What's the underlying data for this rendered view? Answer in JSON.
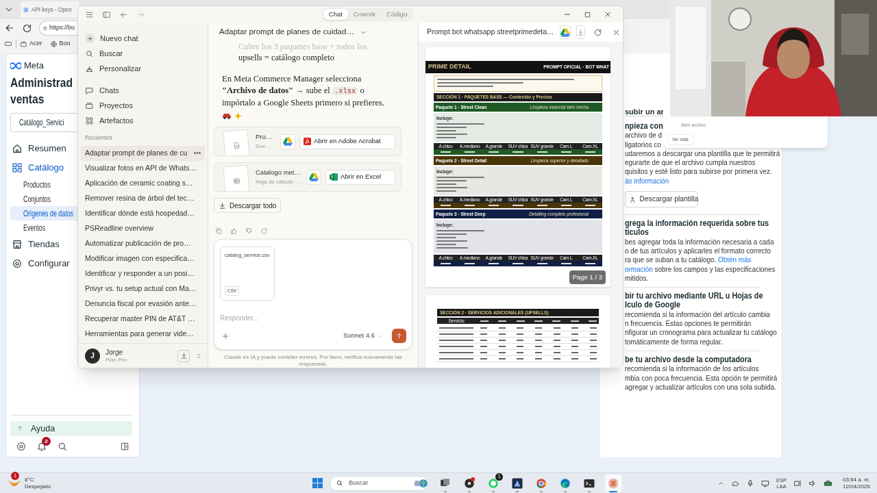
{
  "browser": {
    "tab_title": "API keys - Open",
    "address": "https://bu",
    "bookmarks": [
      "Acer",
      "Boo"
    ]
  },
  "meta_sidebar": {
    "logo": "Meta",
    "title": [
      "Administrad",
      "ventas"
    ],
    "catalog_selector": "Catálogo_Servici",
    "nav": [
      {
        "label": "Resumen",
        "kind": "section",
        "selected": false
      },
      {
        "label": "Catálogo",
        "kind": "section",
        "selected": true
      },
      {
        "label": "Productos",
        "kind": "sub",
        "selected": false
      },
      {
        "label": "Conjuntos",
        "kind": "sub",
        "selected": false
      },
      {
        "label": "Orígenes de datos",
        "kind": "sub",
        "selected": true
      },
      {
        "label": "Eventos",
        "kind": "sub",
        "selected": false
      },
      {
        "label": "Tiendas",
        "kind": "section",
        "selected": false
      },
      {
        "label": "Configurar",
        "kind": "section",
        "selected": false
      }
    ],
    "help": "Ayuda",
    "notification_count": "2"
  },
  "meta_content": {
    "tab": "subir un ar",
    "blocks": [
      {
        "kind": "heading",
        "lines": [
          [
            "npieza con"
          ]
        ]
      },
      {
        "kind": "text",
        "lines": [
          [
            "archivo de d"
          ],
          [
            "ligatorios co"
          ],
          [
            "udaremos a descargar una plantilla que te permitirá"
          ],
          [
            "egurarte de que el archivo cumpla nuestros"
          ],
          [
            "quisitos y esté listo para subirse por primera vez."
          ],
          [
            {
              "link": "ás información"
            }
          ]
        ]
      },
      {
        "kind": "button",
        "label": "Descargar plantilla"
      },
      {
        "kind": "heading",
        "lines": [
          [
            "grega la información requerida sobre tus"
          ],
          [
            "tículos"
          ]
        ]
      },
      {
        "kind": "text",
        "lines": [
          [
            "bes agregar toda la información necesaria a cada"
          ],
          [
            "o de tus artículos y aplicarles el formato correcto"
          ],
          [
            "ra que se suban a tu catálogo. ",
            {
              "link": "Obtén más"
            }
          ],
          [
            {
              "link": "ormación"
            },
            " sobre los campos y las especificaciones"
          ],
          [
            "mitidos."
          ]
        ]
      },
      {
        "kind": "heading",
        "lines": [
          [
            "bir tu archivo mediante URL u Hojas de"
          ],
          [
            "lculo de Google"
          ]
        ]
      },
      {
        "kind": "text",
        "lines": [
          [
            "recomienda si la información del artículo cambia"
          ],
          [
            "n frecuencia. Estas opciones te permitirán"
          ],
          [
            "nfigurar un cronograma para actualizar tu catálogo"
          ],
          [
            "tomáticamente de forma regular."
          ]
        ]
      },
      {
        "kind": "heading",
        "lines": [
          [
            "be tu archivo desde la computadora"
          ]
        ]
      },
      {
        "kind": "text",
        "lines": [
          [
            "recomienda si la información de los artículos"
          ],
          [
            "mbia con poca frecuencia. Esta opción te permitirá"
          ],
          [
            "agregar y actualizar artículos con una sola subida."
          ]
        ]
      }
    ],
    "popup": {
      "subtitle": "Abrir archivo",
      "button": "Ver más"
    }
  },
  "claude": {
    "tabs": [
      {
        "label": "Chat",
        "selected": true
      },
      {
        "label": "Cowork",
        "selected": false
      },
      {
        "label": "Código",
        "selected": false
      }
    ],
    "sidebar": {
      "actions": [
        "Nuevo chat",
        "Buscar",
        "Personalizar"
      ],
      "sections": [
        "Chats",
        "Proyectos",
        "Artefactos"
      ],
      "recents_label": "Recientes",
      "recents": [
        {
          "title": "Adaptar prompt de planes de cu",
          "selected": true
        },
        {
          "title": "Visualizar fotos en API de Whats…",
          "selected": false
        },
        {
          "title": "Aplicación de ceramic coating s…",
          "selected": false
        },
        {
          "title": "Remover resina de árbol del tec…",
          "selected": false
        },
        {
          "title": "Identificar dónde está hospedad…",
          "selected": false
        },
        {
          "title": "PSReadline overview",
          "selected": false
        },
        {
          "title": "Automatizar publicación de pro…",
          "selected": false
        },
        {
          "title": "Modificar imagen con especifica…",
          "selected": false
        },
        {
          "title": "Identificar y responder a un posi…",
          "selected": false
        },
        {
          "title": "Privyr vs. tu setup actual con Ma…",
          "selected": false
        },
        {
          "title": "Denuncia fiscal por evasión ante…",
          "selected": false
        },
        {
          "title": "Recuperar master PIN de AT&T …",
          "selected": false
        },
        {
          "title": "Herramientas para generar vide…",
          "selected": false
        }
      ],
      "user": {
        "initial": "J",
        "name": "Jorge",
        "plan": "Plan Pro"
      }
    },
    "chat": {
      "title": "Adaptar prompt de planes de cuidad…",
      "faded_line": "Cubre los 3 paquetes base + todos los",
      "bullet_continuation": "upsells = catálogo completo",
      "paragraph": {
        "before": "En Meta Commerce Manager selecciona **\"Archivo de datos\"** → sube el ",
        "code": ".xlsx",
        "after": " o impórtalo a Google Sheets primero si prefieres."
      },
      "files": [
        {
          "kind": "document",
          "name": "Pro…",
          "type": "Doc…",
          "open_label": "Abrir en Adobe Acrobat"
        },
        {
          "kind": "spreadsheet",
          "name": "Catalogo met…",
          "type": "Hoja de cálculo · …",
          "open_label": "Abrir en Excel"
        }
      ],
      "download_all": "Descargar todo"
    },
    "composer": {
      "attachment": {
        "name": "catalog_service.csv",
        "type": "CSV"
      },
      "placeholder": "Responder...",
      "model": "Sonnet 4.6"
    },
    "disclaimer": "Claude es IA y puede cometer errores. Por favor, verifica nuevamente las respuestas.",
    "artifact": {
      "title": "Prompt bot whatsapp streetprimedeta…",
      "page_indicator": "Page 1 / 3",
      "doc": {
        "brand": "PRIME DETAIL",
        "tag": "PROMPT OFICIAL · BOT WHAT",
        "section": "SECCIÓN 1 · PAQUETES BASE — Contenido y Precios",
        "packages": [
          {
            "name": "Paquete 1 · Street Clean",
            "tagline": "Limpieza esencial bien hecha",
            "color": "#1f5a25",
            "includes": "Incluye:",
            "columns": [
              "A.chico",
              "A.mediano",
              "A.grande",
              "SUV chica",
              "SUV grande",
              "Cam.L",
              "Cam.XL"
            ]
          },
          {
            "name": "Paquete 2 · Street Detail",
            "tagline": "Limpieza superior y detallado",
            "color": "#4a3508",
            "includes": "Incluye:",
            "columns": [
              "A.chico",
              "A.mediano",
              "A.grande",
              "SUV chica",
              "SUV grande",
              "Cam.L",
              "Cam.XL"
            ]
          },
          {
            "name": "Paquete 3 · Street Deep",
            "tagline": "Detailing completo profesional",
            "color": "#0f1f45",
            "includes": "Incluye:",
            "columns": [
              "A.chico",
              "A.mediano",
              "A.grande",
              "SUV chica",
              "SUV grande",
              "Cam.L",
              "Cam.XL"
            ]
          }
        ],
        "section2": "SECCIÓN 2 · SERVICIOS ADICIONALES (UPSELLS)",
        "upsell_first_column": "Servicio"
      }
    }
  },
  "taskbar": {
    "weather": {
      "temp": "8°C",
      "condition": "Despejado",
      "badge": "1"
    },
    "search": "Buscar",
    "apps": [
      {
        "kind": "taskview",
        "active": false
      },
      {
        "kind": "obs",
        "active": false
      },
      {
        "kind": "whatsapp",
        "active": false,
        "badge": "1"
      },
      {
        "kind": "vector",
        "active": false
      },
      {
        "kind": "chrome",
        "active": false
      },
      {
        "kind": "edge",
        "active": false
      },
      {
        "kind": "terminal",
        "active": false
      },
      {
        "kind": "claude",
        "active": true
      }
    ],
    "language": [
      "ESP",
      "LAA"
    ],
    "time": "03:54 a. m.",
    "date": "12/04/2026"
  }
}
